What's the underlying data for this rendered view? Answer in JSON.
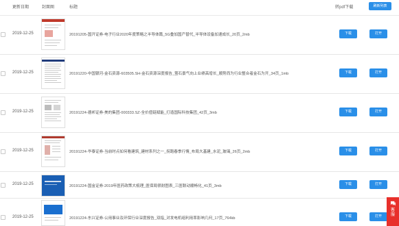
{
  "header": {
    "col_date": "更新日期",
    "col_cover": "封面图",
    "col_title": "标题",
    "col_pdf": "转pdf下载",
    "refresh_label": "刷新列表"
  },
  "buttons": {
    "download": "下载",
    "open": "打开"
  },
  "rows": [
    {
      "date": "2019-12-25",
      "title": "20191205-国开证券-电子行业2020年度策略之半导体篇_5G叠加国产替代_半导体设备加速成长_20页_2mb",
      "cover_accent": "#c0392b"
    },
    {
      "date": "2019-12-25",
      "title": "20191220-中国银河-金石资源-603505.SH-金石资源深度报告_萤石景气向上业绩高增长_顺势而为行业整合者金石为开_34页_1mb",
      "cover_accent": "#1f3a7a"
    },
    {
      "date": "2019-12-25",
      "title": "20191224-德邦证券-美的集团-000333.SZ-全价值链赋能_打造国际科技集团_42页_3mb",
      "cover_accent": "#888888"
    },
    {
      "date": "2019-12-25",
      "title": "20191224-华泰证券-当前时点如何看建筑_建材系列之一_拐跑春季行情_布局大基建_水泥_玻璃_26页_2mb",
      "cover_accent": "#b03a2e"
    },
    {
      "date": "2019-12-25",
      "title": "20191224-国金证券-2019年医药政策大梳理_医保局很耐图表_三医联动顺畅化_41页_3mb",
      "cover_accent": "#1a5fb4"
    },
    {
      "date": "2019-12-25",
      "title": "20191224-东兴证券-公用事业及环保行业深度报告_双指_对发电机组利用率影响几何_17页_764kb",
      "cover_accent": "#1a6fcf"
    }
  ],
  "side_tab": {
    "label": "客服"
  }
}
